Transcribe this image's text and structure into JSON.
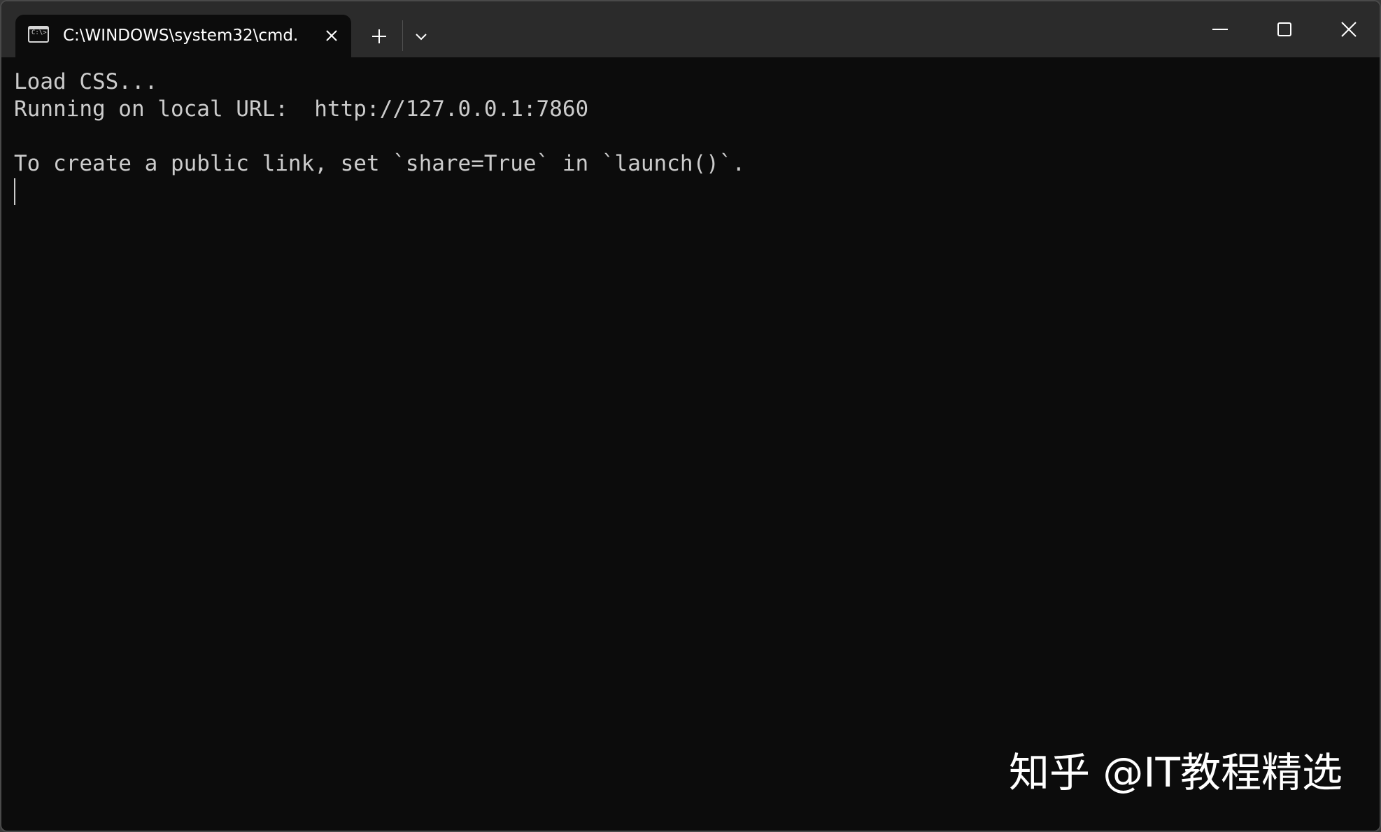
{
  "window": {
    "tab_title": "C:\\WINDOWS\\system32\\cmd.",
    "tab_icon": "cmd-terminal-icon",
    "tab_icon_prompt": "C:\\>",
    "buttons": {
      "close_tab": "close-icon",
      "new_tab": "plus-icon",
      "dropdown": "chevron-down-icon",
      "minimize": "minimize-icon",
      "maximize": "maximize-icon",
      "close": "close-icon"
    }
  },
  "console": {
    "lines": [
      "Load CSS...",
      "Running on local URL:  http://127.0.0.1:7860",
      "",
      "To create a public link, set `share=True` in `launch()`."
    ]
  },
  "watermark": {
    "text": "知乎 @IT教程精选"
  },
  "colors": {
    "titlebar": "#2b2b2b",
    "console_bg": "#0c0c0c",
    "console_text": "#cccccc",
    "icon": "#ffffff"
  }
}
